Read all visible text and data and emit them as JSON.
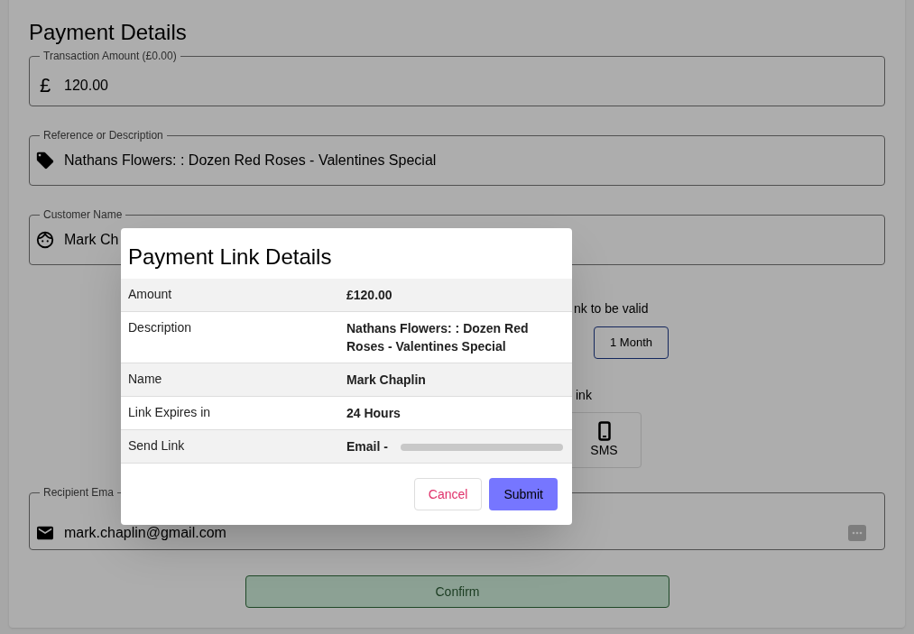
{
  "page": {
    "title": "Payment Details",
    "fields": [
      {
        "kind": "currency",
        "label": "Transaction Amount (£0.00)",
        "symbol": "£",
        "value": "120.00"
      },
      {
        "kind": "tag",
        "label": "Reference or Description",
        "value": "Nathans Flowers: : Dozen Red Roses - Valentines Special"
      },
      {
        "kind": "person",
        "label": "Customer Name",
        "value": "Mark Ch"
      }
    ],
    "validity_prompt": "nk to be valid",
    "validity_options": [
      {
        "label": "1 Month",
        "selected": true
      }
    ],
    "send_prompt": "ink",
    "send_options": [
      {
        "label": "SMS",
        "selected": false
      }
    ],
    "recipient": {
      "label": "Recipient Ema",
      "value": "mark.chaplin@gmail.com"
    },
    "confirm_button": "Confirm"
  },
  "dialog": {
    "title": "Payment Link Details",
    "rows": [
      {
        "label": "Amount",
        "value": "£120.00"
      },
      {
        "label": "Description",
        "value": "Nathans Flowers: : Dozen Red Roses - Valentines Special"
      },
      {
        "label": "Name",
        "value": "Mark Chaplin"
      },
      {
        "label": "Link Expires in",
        "value": "24 Hours"
      },
      {
        "label": "Send Link",
        "value": "Email - ",
        "redacted": true
      }
    ],
    "buttons": [
      {
        "label": "Cancel",
        "kind": "secondary"
      },
      {
        "label": "Submit",
        "kind": "primary"
      }
    ]
  }
}
